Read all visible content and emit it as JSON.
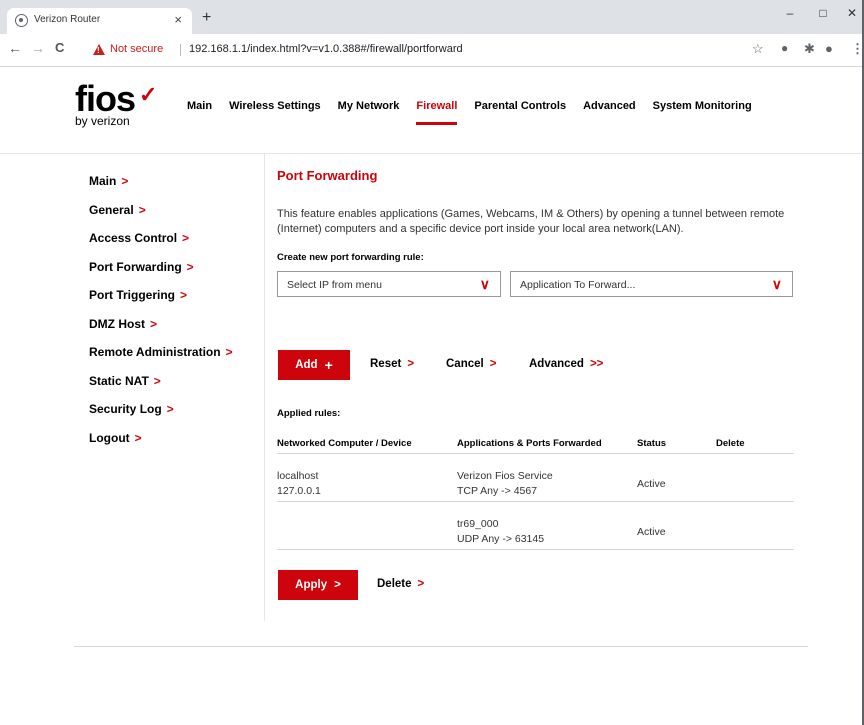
{
  "browser": {
    "tab_title": "Verizon Router",
    "tab_close": "×",
    "new_tab": "+",
    "minimize": "–",
    "maximize": "□",
    "close": "✕",
    "back": "←",
    "forward": "→",
    "reload": "C",
    "not_secure": "Not secure",
    "url": "192.168.1.1/index.html?v=v1.0.388#/firewall/portforward"
  },
  "logo": {
    "brand": "fios",
    "check": "✓",
    "byline": "by verizon"
  },
  "nav": [
    {
      "label": "Main"
    },
    {
      "label": "Wireless Settings"
    },
    {
      "label": "My Network"
    },
    {
      "label": "Firewall"
    },
    {
      "label": "Parental Controls"
    },
    {
      "label": "Advanced"
    },
    {
      "label": "System Monitoring"
    }
  ],
  "nav_active": "Firewall",
  "chevron": ">",
  "sidebar": [
    {
      "label": "Main"
    },
    {
      "label": "General"
    },
    {
      "label": "Access Control"
    },
    {
      "label": "Port Forwarding"
    },
    {
      "label": "Port Triggering"
    },
    {
      "label": "DMZ Host"
    },
    {
      "label": "Remote Administration"
    },
    {
      "label": "Static NAT"
    },
    {
      "label": "Security Log"
    },
    {
      "label": "Logout"
    }
  ],
  "page": {
    "title": "Port Forwarding",
    "description": "This feature enables applications (Games, Webcams, IM & Others) by opening a tunnel between remote (Internet) computers and a specific device port inside your local area network(LAN).",
    "create_label": "Create new port forwarding rule:",
    "ip_select": "Select IP from menu",
    "app_select": "Application To Forward...",
    "add": "Add",
    "add_icon": "+",
    "reset": "Reset",
    "cancel": "Cancel",
    "advanced": "Advanced",
    "advanced_chev": ">>",
    "applied_label": "Applied rules:",
    "columns": [
      "Networked Computer / Device",
      "Applications & Ports Forwarded",
      "Status",
      "Delete"
    ],
    "rules": [
      {
        "device": "localhost",
        "ip": "127.0.0.1",
        "app": "Verizon Fios Service",
        "ports": "TCP Any -> 4567",
        "status": "Active"
      },
      {
        "device": "",
        "ip": "",
        "app": "tr69_000",
        "ports": "UDP Any -> 63145",
        "status": "Active"
      }
    ],
    "apply": "Apply",
    "delete": "Delete"
  },
  "colors": {
    "brand_red": "#cd040b"
  }
}
